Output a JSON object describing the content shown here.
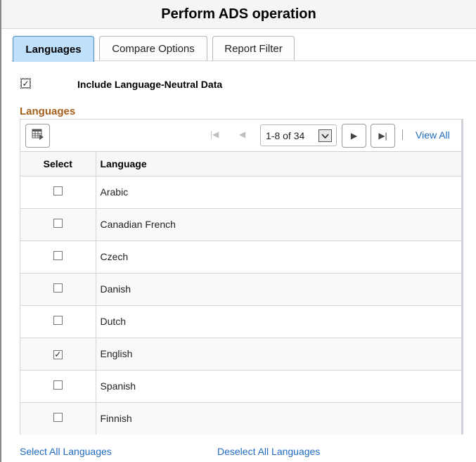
{
  "header": {
    "title": "Perform ADS operation"
  },
  "tabs": [
    {
      "label": "Languages",
      "active": true
    },
    {
      "label": "Compare Options",
      "active": false
    },
    {
      "label": "Report Filter",
      "active": false
    }
  ],
  "options": {
    "include_language_neutral": {
      "label": "Include Language-Neutral Data",
      "checked": true
    }
  },
  "section": {
    "title": "Languages"
  },
  "grid": {
    "toolbar": {
      "personalize_icon": "grid-settings-icon",
      "page_range": "1-8 of 34",
      "view_all_label": "View All",
      "first_icon": "first-page-icon",
      "prev_icon": "previous-page-icon",
      "next_icon": "next-page-icon",
      "last_icon": "last-page-icon"
    },
    "columns": [
      "Select",
      "Language"
    ],
    "rows": [
      {
        "language": "Arabic",
        "selected": false
      },
      {
        "language": "Canadian French",
        "selected": false
      },
      {
        "language": "Czech",
        "selected": false
      },
      {
        "language": "Danish",
        "selected": false
      },
      {
        "language": "Dutch",
        "selected": false
      },
      {
        "language": "English",
        "selected": true
      },
      {
        "language": "Spanish",
        "selected": false
      },
      {
        "language": "Finnish",
        "selected": false
      }
    ]
  },
  "footer": {
    "select_all_label": "Select All Languages",
    "deselect_all_label": "Deselect All Languages"
  },
  "colors": {
    "active_tab_bg": "#bfe0fb",
    "section_title": "#a65f1a",
    "link": "#1f6bc1"
  }
}
